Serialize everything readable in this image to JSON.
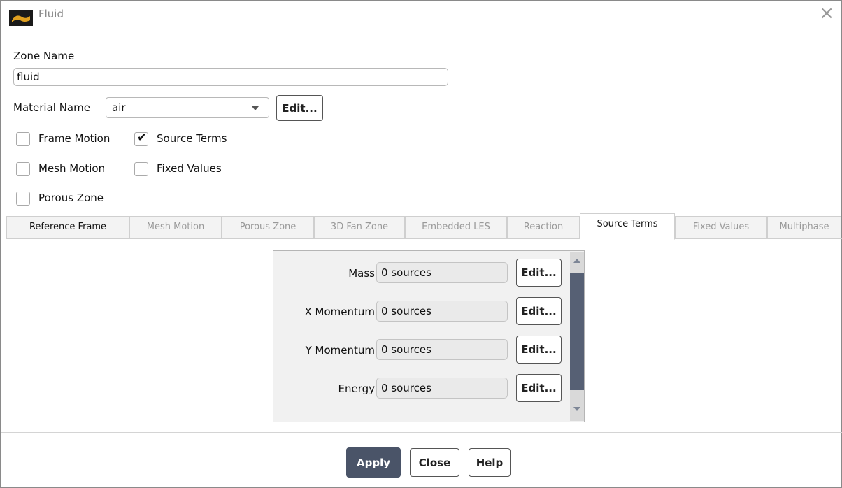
{
  "window": {
    "title": "Fluid",
    "close_glyph": "×"
  },
  "zone": {
    "label": "Zone Name",
    "value": "fluid"
  },
  "material": {
    "label": "Material Name",
    "value": "air",
    "edit_label": "Edit..."
  },
  "options": {
    "frame_motion": {
      "label": "Frame Motion",
      "checked": false
    },
    "source_terms": {
      "label": "Source Terms",
      "checked": true
    },
    "mesh_motion": {
      "label": "Mesh Motion",
      "checked": false
    },
    "fixed_values": {
      "label": "Fixed Values",
      "checked": false
    },
    "porous_zone": {
      "label": "Porous Zone",
      "checked": false
    },
    "check_glyph": "✔"
  },
  "tabs": [
    {
      "label": "Reference Frame",
      "active": false
    },
    {
      "label": "Mesh Motion",
      "active": false
    },
    {
      "label": "Porous Zone",
      "active": false
    },
    {
      "label": "3D Fan Zone",
      "active": false
    },
    {
      "label": "Embedded LES",
      "active": false
    },
    {
      "label": "Reaction",
      "active": false
    },
    {
      "label": "Source Terms",
      "active": true
    },
    {
      "label": "Fixed Values",
      "active": false
    },
    {
      "label": "Multiphase",
      "active": false
    }
  ],
  "source_terms": [
    {
      "label": "Mass",
      "value": "0 sources",
      "edit_label": "Edit..."
    },
    {
      "label": "X Momentum",
      "value": "0 sources",
      "edit_label": "Edit..."
    },
    {
      "label": "Y Momentum",
      "value": "0 sources",
      "edit_label": "Edit..."
    },
    {
      "label": "Energy",
      "value": "0 sources",
      "edit_label": "Edit..."
    }
  ],
  "footer": {
    "apply_label": "Apply",
    "close_label": "Close",
    "help_label": "Help"
  },
  "colors": {
    "apply_bg": "#4a5468",
    "scroll_thumb": "#566074",
    "icon_orange": "#e0a020"
  }
}
